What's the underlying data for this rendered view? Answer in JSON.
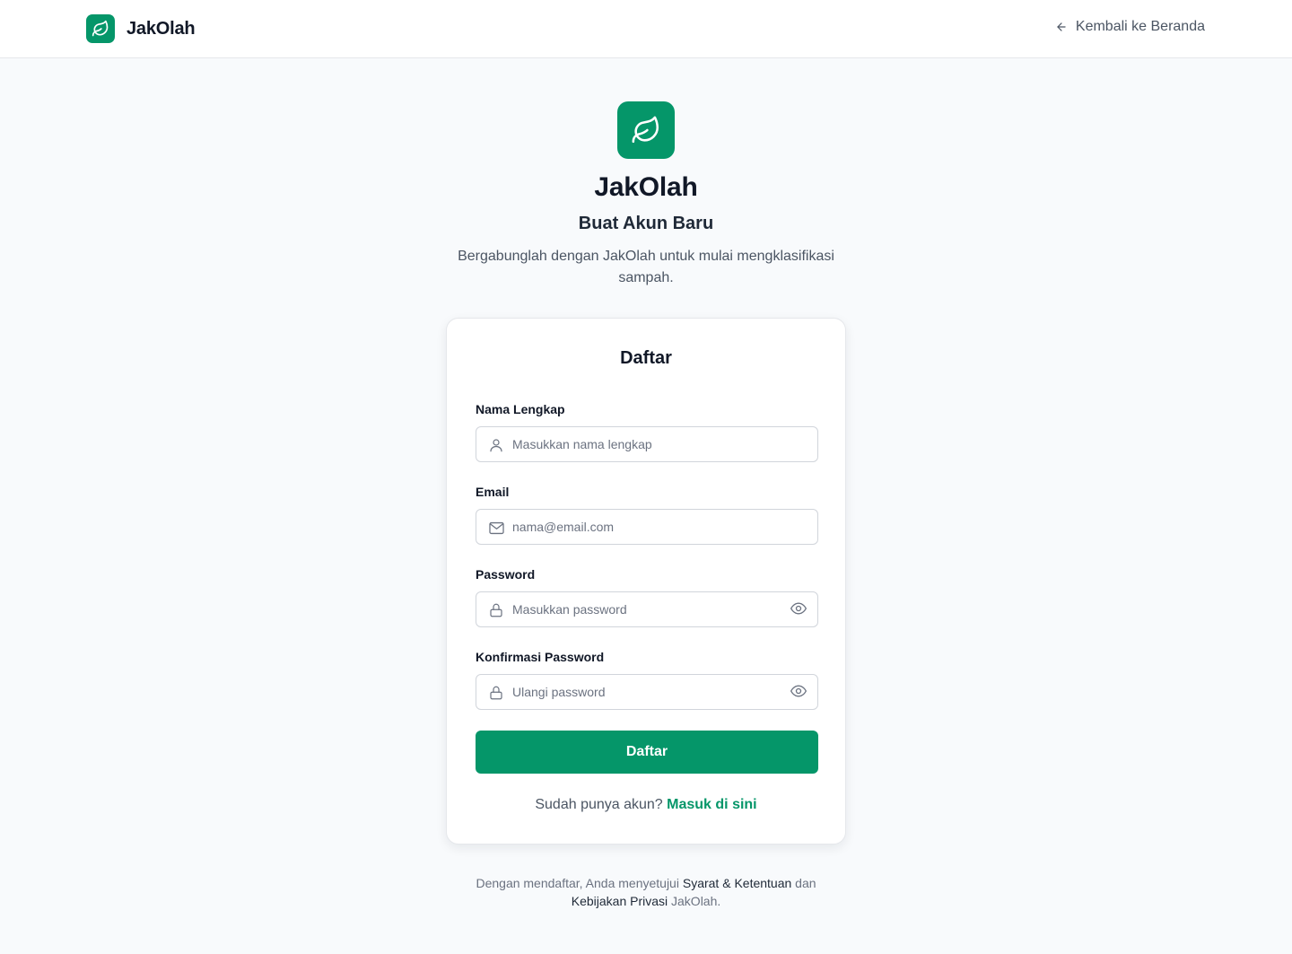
{
  "brand": {
    "name": "JakOlah",
    "logo_icon": "leaf-icon",
    "accent_color": "#059669"
  },
  "nav": {
    "back_label": "Kembali ke Beranda",
    "back_icon": "arrow-left-icon"
  },
  "hero": {
    "title": "JakOlah",
    "subtitle": "Buat Akun Baru",
    "description": "Bergabunglah dengan JakOlah untuk mulai mengklasifikasi sampah."
  },
  "form": {
    "title": "Daftar",
    "fields": {
      "name": {
        "label": "Nama Lengkap",
        "placeholder": "Masukkan nama lengkap",
        "value": "",
        "icon": "user-icon"
      },
      "email": {
        "label": "Email",
        "placeholder": "nama@email.com",
        "value": "",
        "icon": "mail-icon"
      },
      "password": {
        "label": "Password",
        "placeholder": "Masukkan password",
        "value": "",
        "icon": "lock-icon",
        "toggle_icon": "eye-icon"
      },
      "confirm_password": {
        "label": "Konfirmasi Password",
        "placeholder": "Ulangi password",
        "value": "",
        "icon": "lock-icon",
        "toggle_icon": "eye-icon"
      }
    },
    "submit_label": "Daftar",
    "login_prompt": "Sudah punya akun?",
    "login_link": "Masuk di sini"
  },
  "terms": {
    "prefix": "Dengan mendaftar, Anda menyetujui",
    "terms_link": "Syarat & Ketentuan",
    "conjunction": "dan",
    "privacy_link": "Kebijakan Privasi",
    "suffix": "JakOlah."
  }
}
